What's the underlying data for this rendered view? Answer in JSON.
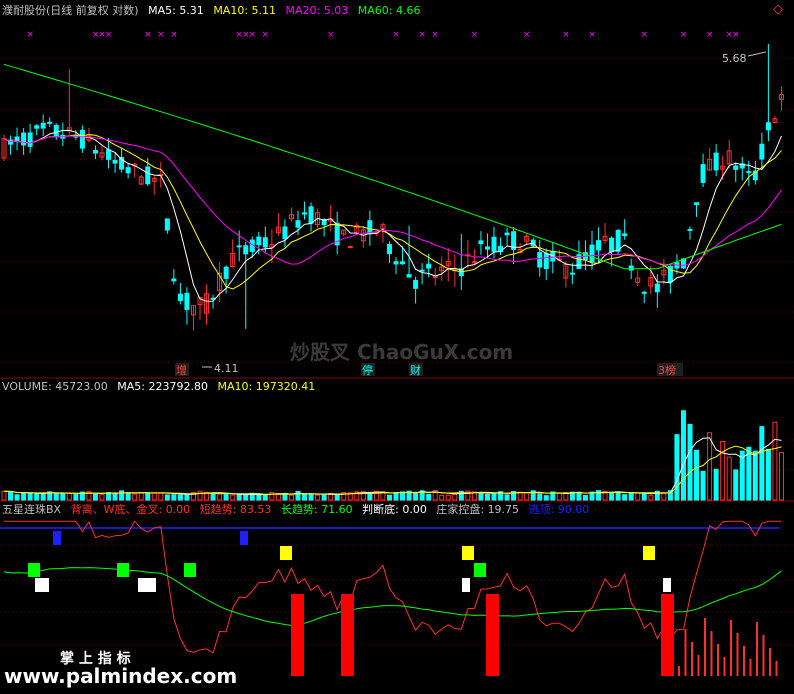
{
  "chart_data": {
    "type": "candlestick",
    "price_panel": {
      "stock_name": "濮耐股份",
      "mode": "(日线 前复权 对数)",
      "indicators": [
        {
          "label": "MA5:",
          "value": "5.31",
          "color": "#ffffff"
        },
        {
          "label": "MA10:",
          "value": "5.11",
          "color": "#ffff00"
        },
        {
          "label": "MA20:",
          "value": "5.03",
          "color": "#ff00ff"
        },
        {
          "label": "MA60:",
          "value": "4.66",
          "color": "#00ff00"
        }
      ],
      "high_label": "5.68",
      "low_label": "4.11",
      "markers": [
        {
          "text": "增",
          "color": "#ff4040"
        },
        {
          "text": "停",
          "color": "#00ffff"
        },
        {
          "text": "财",
          "color": "#00ffff"
        },
        {
          "text": "3榜",
          "color": "#ff4040"
        }
      ],
      "y_range": [
        3.9,
        5.85
      ],
      "ma_colors": {
        "ma5": "#ffffff",
        "ma10": "#ffff00",
        "ma20": "#ff00ff",
        "ma60": "#00ff00"
      },
      "up_color": "#ff3030",
      "down_color": "#00ffff"
    },
    "volume_panel": {
      "title": "VOLUME:",
      "indicators": [
        {
          "label": "VOLUME:",
          "value": "45723.00",
          "color": "#c0c0c0"
        },
        {
          "label": "MA5:",
          "value": "223792.80",
          "color": "#ffffff"
        },
        {
          "label": "MA10:",
          "value": "197320.41",
          "color": "#ffff00"
        }
      ]
    },
    "indicator_panel": {
      "indicators": [
        {
          "label": "五星连珠BX",
          "value": "",
          "color": "#c0c0c0"
        },
        {
          "label": "背离、W底、金叉:",
          "value": "0.00",
          "color": "#ff3030"
        },
        {
          "label": "短趋势:",
          "value": "83.53",
          "color": "#ff3030"
        },
        {
          "label": "长趋势:",
          "value": "71.60",
          "color": "#00ff00"
        },
        {
          "label": "判断底:",
          "value": "0.00",
          "color": "#ffffff"
        },
        {
          "label": "庄家控盘:",
          "value": "19.75",
          "color": "#c0c0c0"
        },
        {
          "label": "逃顶:",
          "value": "90.00",
          "color": "#2020ff"
        }
      ]
    }
  },
  "watermarks": {
    "center": "炒股叉 ChaoGuX.com",
    "bottom_cn": "掌 上 指 标",
    "bottom_url": "www.palmindex.com"
  },
  "icons": {
    "corner": "diamond-icon"
  }
}
